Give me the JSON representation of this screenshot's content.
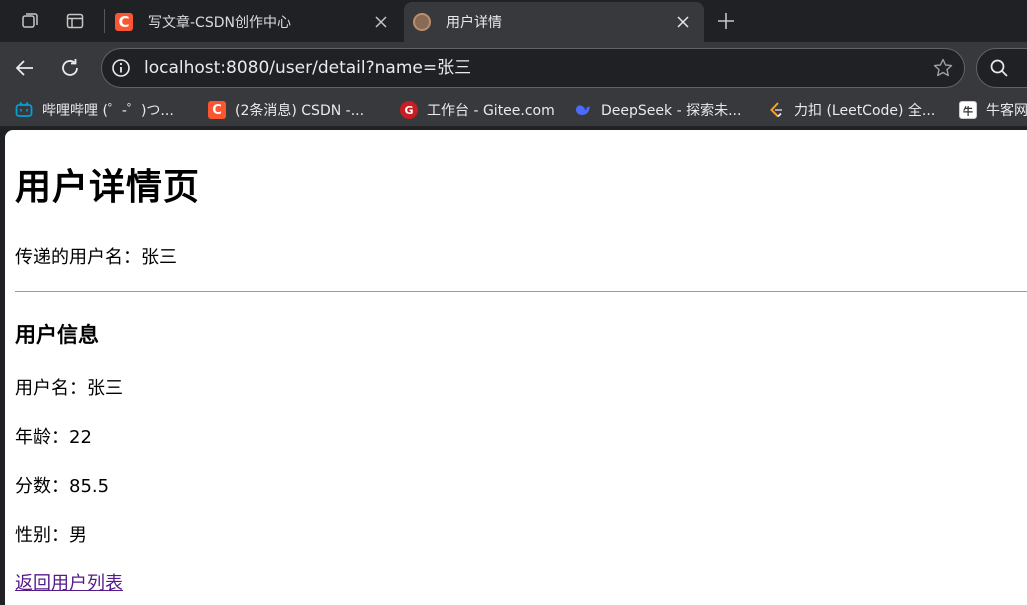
{
  "browser": {
    "tabs": [
      {
        "title": "写文章-CSDN创作中心",
        "favicon": "csdn-icon",
        "favicon_letter": "C",
        "active": false
      },
      {
        "title": "用户详情",
        "favicon": "site-icon",
        "active": true
      }
    ],
    "address": "localhost:8080/user/detail?name=张三",
    "bookmarks": [
      {
        "label": "哔哩哔哩 (゜-゜)つ...",
        "icon": "bilibili-icon"
      },
      {
        "label": "(2条消息) CSDN -...",
        "icon": "csdn-icon"
      },
      {
        "label": "工作台 - Gitee.com",
        "icon": "gitee-icon"
      },
      {
        "label": "DeepSeek - 探索未...",
        "icon": "deepseek-icon"
      },
      {
        "label": "力扣 (LeetCode) 全...",
        "icon": "leetcode-icon"
      },
      {
        "label": "牛客网",
        "icon": "nowcoder-icon"
      }
    ]
  },
  "page": {
    "heading": "用户详情页",
    "passed_name": "传递的用户名：张三",
    "section_title": "用户信息",
    "username": "用户名：张三",
    "age": "年龄：22",
    "score": "分数：85.5",
    "gender": "性别：男",
    "back_link": "返回用户列表"
  },
  "colors": {
    "chrome_dark": "#202124",
    "chrome_toolbar": "#37393d",
    "csdn_brand": "#fc5531",
    "visited_link": "#551a8b"
  }
}
